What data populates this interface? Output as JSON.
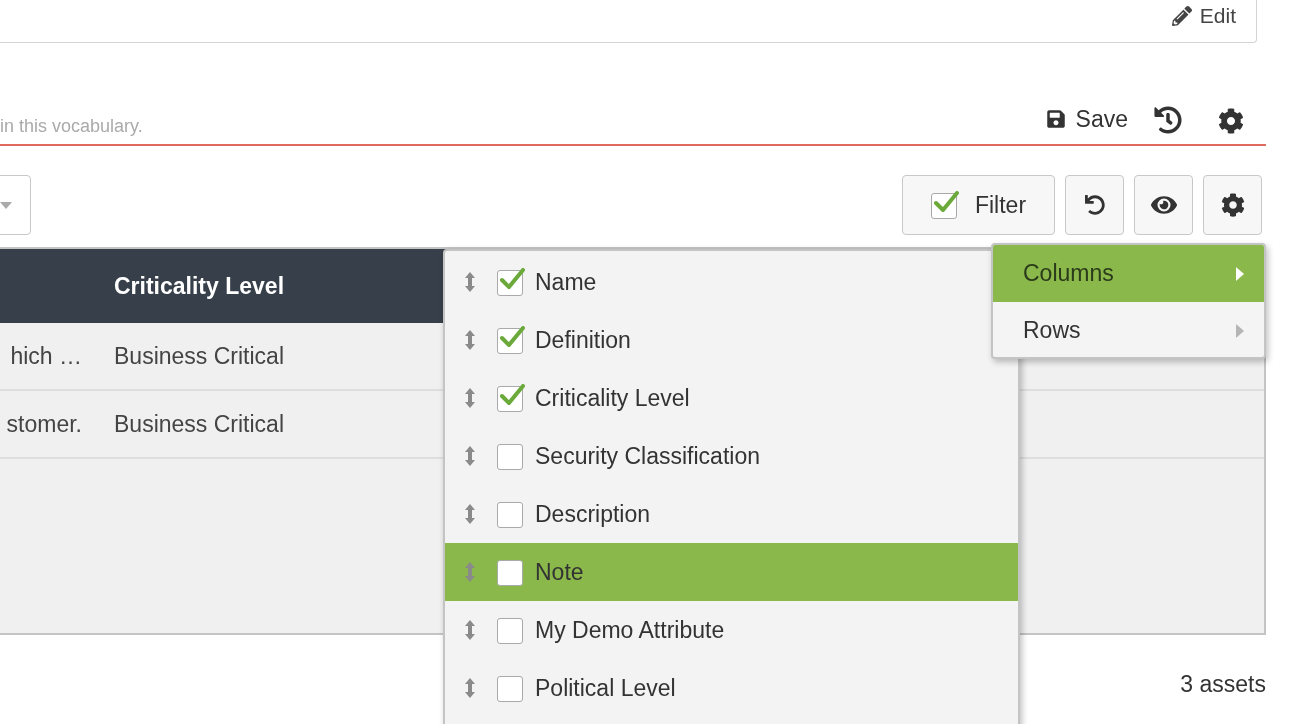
{
  "header_card": {
    "edit_button": "Edit"
  },
  "description": {
    "placeholder": "in this vocabulary."
  },
  "actions": {
    "save_button": "Save"
  },
  "toolbar": {
    "filter_button": {
      "label": "Filter",
      "checked": true
    }
  },
  "table": {
    "columns": [
      {},
      {
        "label": "Criticality Level"
      }
    ],
    "rows": [
      {
        "cells": [
          "hich …",
          "Business Critical"
        ]
      },
      {
        "cells": [
          "stomer.",
          "Business Critical"
        ]
      }
    ]
  },
  "column_menu": {
    "items": [
      {
        "label": "Name",
        "checked": true,
        "selected": false
      },
      {
        "label": "Definition",
        "checked": true,
        "selected": false
      },
      {
        "label": "Criticality Level",
        "checked": true,
        "selected": false
      },
      {
        "label": "Security Classification",
        "checked": false,
        "selected": false
      },
      {
        "label": "Description",
        "checked": false,
        "selected": false
      },
      {
        "label": "Note",
        "checked": false,
        "selected": true
      },
      {
        "label": "My Demo Attribute",
        "checked": false,
        "selected": false
      },
      {
        "label": "Political Level",
        "checked": false,
        "selected": false
      }
    ]
  },
  "view_menu": {
    "items": [
      {
        "label": "Columns",
        "selected": true
      },
      {
        "label": "Rows",
        "selected": false
      }
    ]
  },
  "footer": {
    "count": "3 assets"
  }
}
